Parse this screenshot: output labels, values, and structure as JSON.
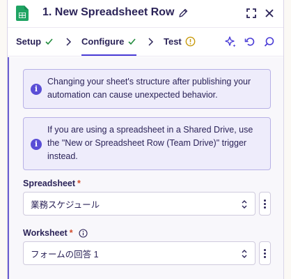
{
  "header": {
    "title": "1. New Spreadsheet Row",
    "app_icon": "google-sheets-icon"
  },
  "tabs": [
    {
      "label": "Setup",
      "status": "check-icon"
    },
    {
      "label": "Configure",
      "status": "check-icon"
    },
    {
      "label": "Test",
      "status": "warning-icon"
    }
  ],
  "alerts": [
    {
      "text": "Changing your sheet's structure after publishing your automation can cause unexpected behavior."
    },
    {
      "text": "If you are using a spreadsheet in a Shared Drive, use the \"New or Spreadsheet Row (Team Drive)\" trigger instead."
    }
  ],
  "fields": {
    "spreadsheet": {
      "label": "Spreadsheet",
      "required_mark": "*",
      "value": "業務スケジュール"
    },
    "worksheet": {
      "label": "Worksheet",
      "required_mark": "*",
      "value": "フォームの回答 1"
    }
  },
  "colors": {
    "accent": "#4a3cd6",
    "check": "#1f8a3b",
    "warning": "#c89a0c",
    "required": "#d14b2b",
    "sheets_green": "#1fa463"
  }
}
